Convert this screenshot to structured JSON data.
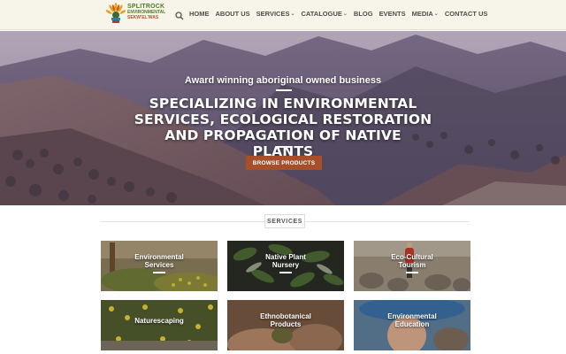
{
  "logo": {
    "line1": "SPLITROCK",
    "line2": "ENVIRONMENTAL",
    "line3": "SEKW'EL'WAS"
  },
  "nav": {
    "items": [
      {
        "label": "HOME"
      },
      {
        "label": "ABOUT US"
      },
      {
        "label": "SERVICES",
        "has_dropdown": true
      },
      {
        "label": "CATALOGUE",
        "has_dropdown": true
      },
      {
        "label": "BLOG"
      },
      {
        "label": "EVENTS"
      },
      {
        "label": "MEDIA",
        "has_dropdown": true
      },
      {
        "label": "CONTACT US"
      }
    ],
    "chevron": "⌄"
  },
  "hero": {
    "tagline": "Award winning aboriginal owned business",
    "title": "SPECIALIZING IN ENVIRONMENTAL SERVICES, ECOLOGICAL RESTORATION AND PROPAGATION OF NATIVE PLANTS",
    "button_label": "BROWSE PRODUCTS"
  },
  "services": {
    "title": "SERVICES",
    "cards": [
      {
        "line1": "Environmental",
        "line2": "Services"
      },
      {
        "line1": "Native Plant",
        "line2": "Nursery"
      },
      {
        "line1": "Eco-Cultural",
        "line2": "Tourism"
      },
      {
        "line1": "Naturescaping",
        "line2": ""
      },
      {
        "line1": "Ethnobotanical",
        "line2": "Products"
      },
      {
        "line1": "Environmental",
        "line2": "Education"
      }
    ]
  },
  "colors": {
    "header_bg": "#f7f5ea",
    "accent": "#a74e2b",
    "logo_green": "#4e7a2d"
  }
}
